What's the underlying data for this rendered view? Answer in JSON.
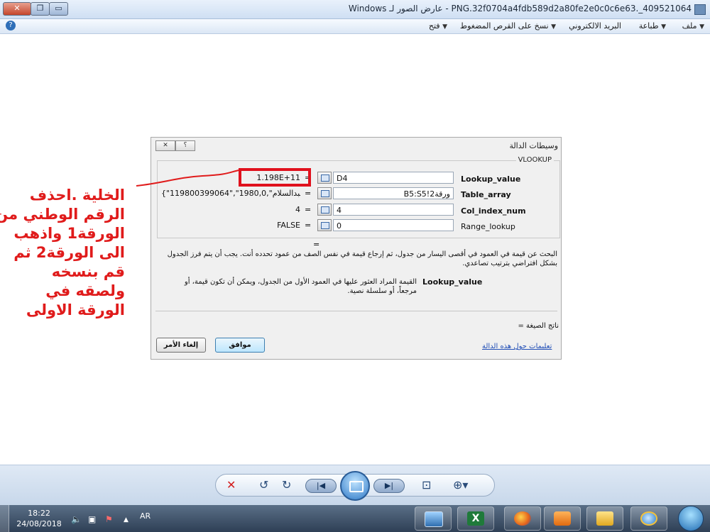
{
  "window": {
    "title": "Windows عارض الصور لـ - PNG.32f0704a4fdb589d2a80fe2e0c0c6e63._409521064",
    "close_glyph": "✕",
    "max_glyph": "❐",
    "min_glyph": "▭"
  },
  "menu": {
    "items": [
      "ملف",
      "طباعة",
      "البريد الالكتروني",
      "نسخ على القرص المضغوط",
      "فتح"
    ],
    "help_glyph": "?"
  },
  "dialog": {
    "title": "وسيطات الدالة",
    "close_glyph": "✕",
    "help_glyph": "؟",
    "function_name": "VLOOKUP",
    "args": [
      {
        "label": "Lookup_value",
        "value": "D4",
        "result": "1.198E+11",
        "bold": true
      },
      {
        "label": "Table_array",
        "value": "ورقة2!B5:S5",
        "result": "{\"119800399064\",\"عبدالسلام\",1980,0,...",
        "bold": true
      },
      {
        "label": "Col_index_num",
        "value": "4",
        "result": "4",
        "bold": true
      },
      {
        "label": "Range_lookup",
        "value": "0",
        "result": "FALSE",
        "bold": false
      }
    ],
    "equals": "=",
    "result_line": "=",
    "description": "البحث عن قيمة في العمود في أقصى اليسار من جدول، ثم إرجاع قيمة في نفس الصف من عمود تحدده أنت. يجب أن يتم فرز الجدول بشكل افتراضي بترتيب تصاعدي.",
    "arg_help_label": "Lookup_value",
    "arg_help_text": "القيمة المراد العثور عليها في العمود الأول من الجدول، ويمكن أن تكون قيمة، أو مرجعاً، أو سلسلة نصية.",
    "formula_result": "ناتج الصيغة =",
    "help_link": "تعليمات حول هذه الدالة",
    "ok_label": "موافق",
    "cancel_label": "إلغاء الأمر"
  },
  "annotation": {
    "lines": [
      "الخلية .احذف",
      "الرقم الوطني من",
      "الورقة1 واذهب",
      "الى الورقة2 ثم",
      "قم بنسخه",
      "ولصقه في",
      "الورقة الاولى"
    ],
    "color": "#e01b1b"
  },
  "viewer": {
    "delete_glyph": "✕",
    "rotate_ccw_glyph": "↺",
    "rotate_cw_glyph": "↻",
    "prev_glyph": "|◀",
    "next_glyph": "▶|",
    "fit_glyph": "⊡",
    "zoom_glyph": "⊕▾"
  },
  "taskbar": {
    "time": "18:22",
    "date": "24/08/2018",
    "lang": "AR",
    "up_glyph": "▲",
    "volume_glyph": "🔈",
    "network_glyph": "▣",
    "flag_glyph": "⚑",
    "excel_letter": "X"
  }
}
